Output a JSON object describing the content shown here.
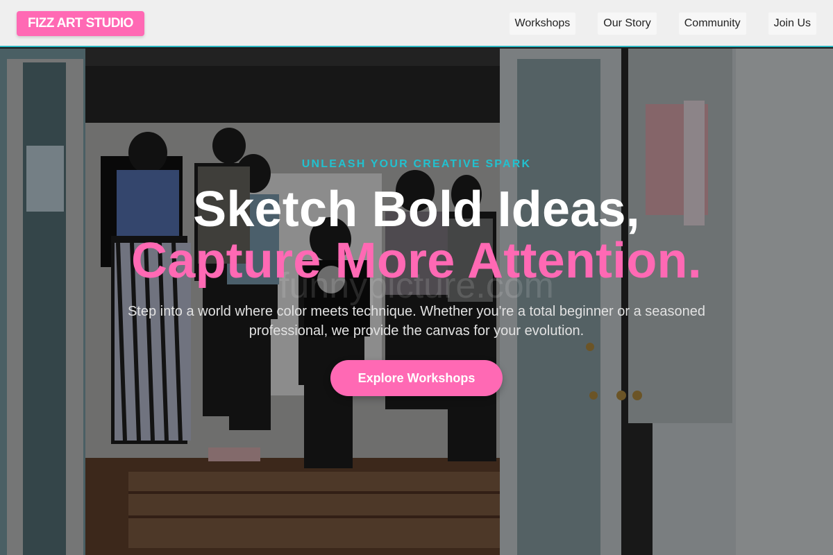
{
  "header": {
    "logo": "FIZZ ART STUDIO",
    "nav": [
      {
        "label": "Workshops"
      },
      {
        "label": "Our Story"
      },
      {
        "label": "Community"
      },
      {
        "label": "Join Us"
      }
    ]
  },
  "hero": {
    "eyebrow": "UNLEASH YOUR CREATIVE SPARK",
    "headline_line1": "Sketch Bold Ideas,",
    "headline_line2": "Capture More Attention.",
    "subtext": "Step into a world where color meets technique. Whether you're a total beginner or a seasoned professional, we provide the canvas for your evolution.",
    "cta_label": "Explore Workshops",
    "watermark": "funnypicture.com"
  },
  "colors": {
    "brand_pink": "#ff69b4",
    "accent_teal": "#22c1cf",
    "header_bg": "#efefef"
  }
}
